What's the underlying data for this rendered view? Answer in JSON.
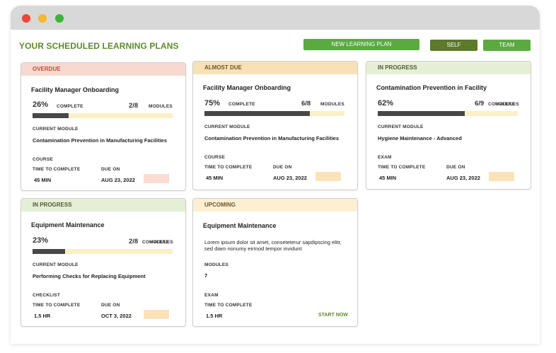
{
  "page": {
    "title": "YOUR SCHEDULED LEARNING PLANS",
    "buttons": {
      "new_plan": "NEW LEARNING PLAN",
      "self": "SELF",
      "team": "TEAM"
    }
  },
  "cards": [
    {
      "status": "OVERDUE",
      "title": "Facility Manager Onboarding",
      "percent": "26%",
      "percent_value": 26,
      "complete_label": "COMPLETE",
      "modules_fraction": "2/8",
      "modules_label": "MODULES",
      "current_module_label": "CURRENT MODULE",
      "current_module": "Contamination Prevention in Manufacturing Facilities",
      "type": "COURSE",
      "time_label": "TIME TO COMPLETE",
      "time": "45 MIN",
      "due_label": "DUE ON",
      "due": "AUG 23, 2022"
    },
    {
      "status": "ALMOST DUE",
      "title": "Facility Manager Onboarding",
      "percent": "75%",
      "percent_value": 75,
      "complete_label": "COMPLETE",
      "modules_fraction": "6/8",
      "modules_label": "MODULES",
      "current_module_label": "CURRENT MODULE",
      "current_module": "Contamination Prevention in Manufacturing Facilities",
      "type": "COURSE",
      "time_label": "TIME TO COMPLETE",
      "time": "45 MIN",
      "due_label": "DUE ON",
      "due": "AUG 23, 2022"
    },
    {
      "status": "IN PROGRESS",
      "title": "Contamination Prevention in Facility",
      "percent": "62%",
      "percent_value": 62,
      "modules_fraction": "6/9",
      "overlap_label_a": "COMPLETE",
      "overlap_label_b": "MODULES",
      "current_module_label": "CURRENT MODULE",
      "current_module": "Hygiene Maintenance - Advanced",
      "type": "EXAM",
      "time_label": "TIME TO COMPLETE",
      "time": "45 MIN",
      "due_label": "DUE ON",
      "due": "AUG 23, 2022"
    },
    {
      "status": "IN PROGRESS",
      "title": "Equipment Maintenance",
      "percent": "23%",
      "percent_value": 23,
      "modules_fraction": "2/8",
      "overlap_label_a": "COMPLETE",
      "overlap_label_b": "MODULES",
      "current_module_label": "CURRENT MODULE",
      "current_module": "Performing Checks for Replacing Equipment",
      "type": "CHECKLIST",
      "time_label": "TIME TO COMPLETE",
      "time": "1.5 HR",
      "due_label": "DUE ON",
      "due": "OCT 3, 2022"
    },
    {
      "status": "UPCOMING",
      "title": "Equipment Maintenance",
      "description": "Lorem ipsum dolor sit amet, conseteterur sapdipscing elitr, sed diam nonumy eirmod tempor invidunt",
      "modules_label": "MODULES",
      "modules_count": "7",
      "type": "EXAM",
      "time_label": "TIME TO COMPLETE",
      "time": "1.5 HR",
      "start_label": "START NOW"
    }
  ]
}
